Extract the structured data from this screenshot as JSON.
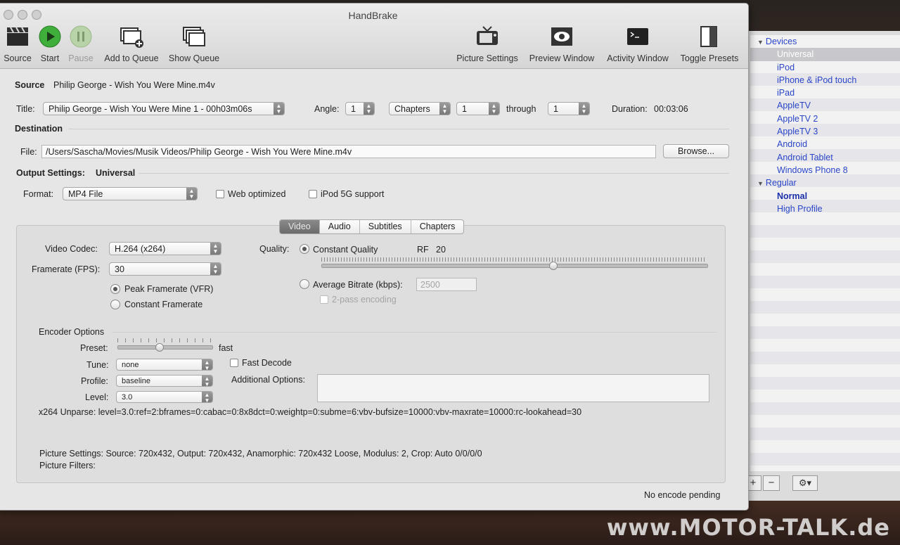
{
  "window": {
    "title": "HandBrake"
  },
  "toolbar": {
    "items": [
      {
        "label": "Source",
        "icon": "clapperboard-icon"
      },
      {
        "label": "Start",
        "icon": "play-icon"
      },
      {
        "label": "Pause",
        "icon": "pause-icon"
      },
      {
        "label": "Add to Queue",
        "icon": "add-to-queue-icon"
      },
      {
        "label": "Show Queue",
        "icon": "show-queue-icon"
      },
      {
        "label": "Picture Settings",
        "icon": "tv-icon"
      },
      {
        "label": "Preview Window",
        "icon": "eye-icon"
      },
      {
        "label": "Activity Window",
        "icon": "terminal-icon"
      },
      {
        "label": "Toggle Presets",
        "icon": "drawer-icon"
      }
    ]
  },
  "source": {
    "label": "Source",
    "value": "Philip George - Wish You Were Mine.m4v"
  },
  "title_row": {
    "title_label": "Title:",
    "title_value": "Philip George - Wish You Were Mine 1 - 00h03m06s",
    "angle_label": "Angle:",
    "angle_value": "1",
    "range_type": "Chapters",
    "range_start": "1",
    "through_label": "through",
    "range_end": "1",
    "duration_label": "Duration:",
    "duration_value": "00:03:06"
  },
  "destination": {
    "heading": "Destination",
    "file_label": "File:",
    "file_value": "/Users/Sascha/Movies/Musik Videos/Philip George - Wish You Were Mine.m4v",
    "browse_label": "Browse..."
  },
  "output": {
    "heading": "Output Settings:",
    "preset": "Universal",
    "format_label": "Format:",
    "format_value": "MP4 File",
    "web_optimized": "Web optimized",
    "ipod_support": "iPod 5G support"
  },
  "tabs": [
    "Video",
    "Audio",
    "Subtitles",
    "Chapters"
  ],
  "video": {
    "codec_label": "Video Codec:",
    "codec_value": "H.264 (x264)",
    "fps_label": "Framerate (FPS):",
    "fps_value": "30",
    "peak_label": "Peak Framerate (VFR)",
    "constant_fr_label": "Constant Framerate",
    "quality_label": "Quality:",
    "cq_label": "Constant Quality",
    "rf_label": "RF",
    "rf_value": "20",
    "quality_slider_fraction": 0.6,
    "avg_bitrate_label": "Average Bitrate (kbps):",
    "avg_bitrate_value": "2500",
    "twopass_label": "2-pass encoding"
  },
  "encoder": {
    "heading": "Encoder Options",
    "preset_label": "Preset:",
    "preset_value": "fast",
    "tune_label": "Tune:",
    "tune_value": "none",
    "profile_label": "Profile:",
    "profile_value": "baseline",
    "level_label": "Level:",
    "level_value": "3.0",
    "fast_decode": "Fast Decode",
    "additional_label": "Additional Options:",
    "unparse": "x264 Unparse: level=3.0:ref=2:bframes=0:cabac=0:8x8dct=0:weightp=0:subme=6:vbv-bufsize=10000:vbv-maxrate=10000:rc-lookahead=30"
  },
  "summary": {
    "picture_settings": "Picture Settings: Source: 720x432, Output: 720x432, Anamorphic: 720x432 Loose, Modulus: 2, Crop: Auto 0/0/0/0",
    "picture_filters": "Picture Filters:"
  },
  "status": "No encode pending",
  "presets": {
    "groups": [
      {
        "name": "Devices",
        "items": [
          "Universal",
          "iPod",
          "iPhone & iPod touch",
          "iPad",
          "AppleTV",
          "AppleTV 2",
          "AppleTV 3",
          "Android",
          "Android Tablet",
          "Windows Phone 8"
        ]
      },
      {
        "name": "Regular",
        "items": [
          "Normal",
          "High Profile"
        ]
      }
    ],
    "add": "+",
    "remove": "−",
    "gear": "⚙▾"
  },
  "watermark": "www.MOTOR-TALK.de",
  "colors": {
    "preset_link": "#2a45c9",
    "start_green": "#3fae3a"
  }
}
